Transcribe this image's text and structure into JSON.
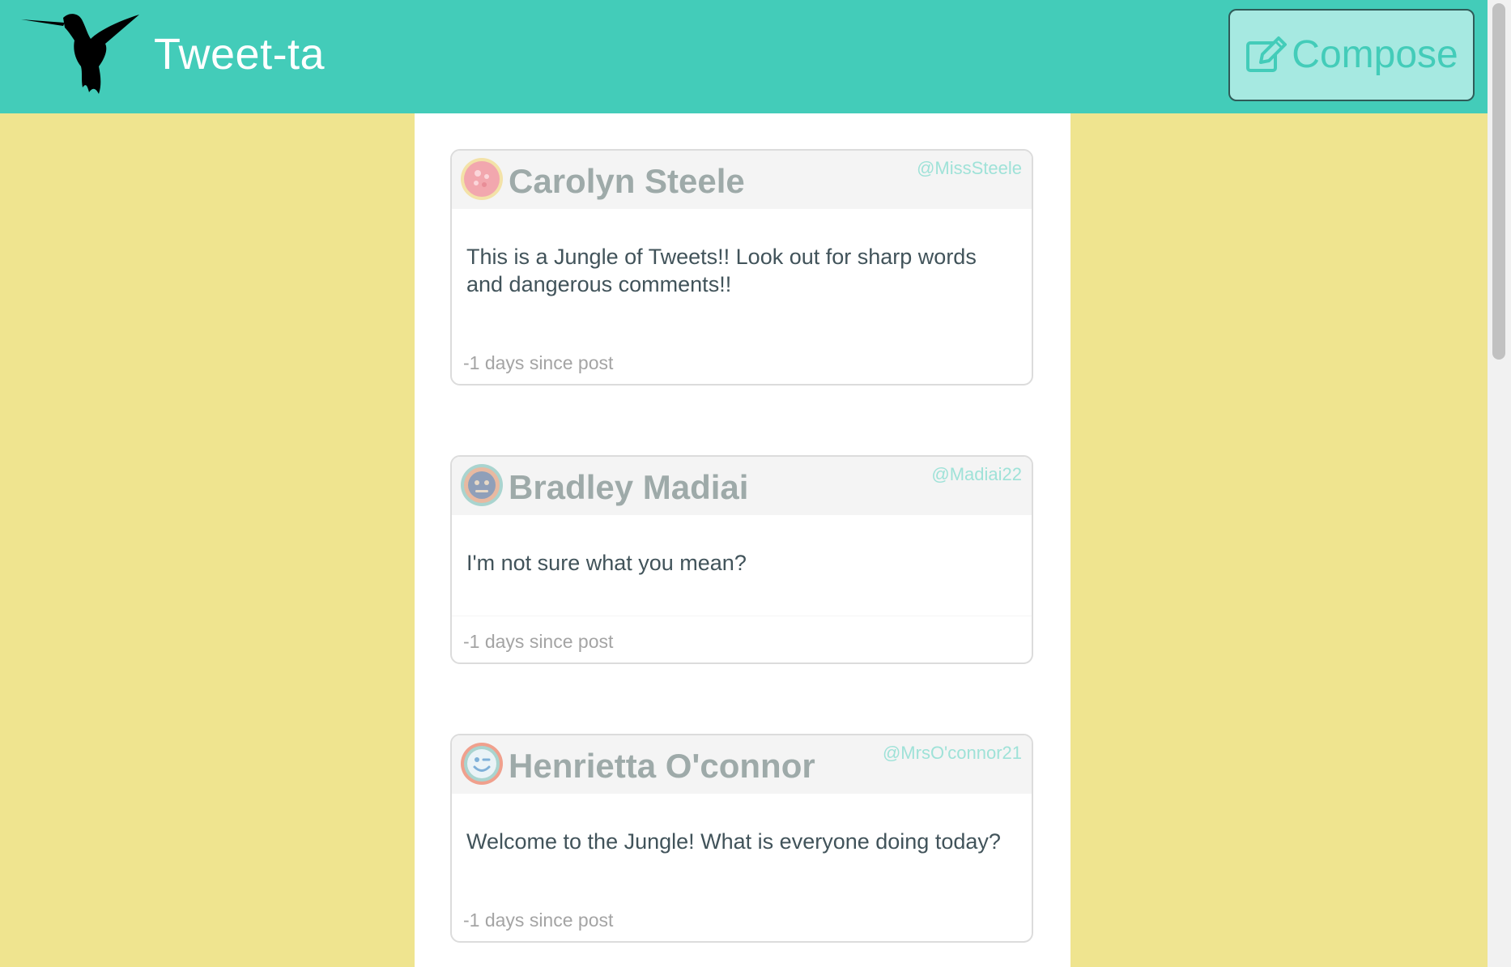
{
  "app": {
    "brand_name": "Tweet-ta",
    "compose_label": "Compose",
    "logo_icon": "hummingbird-icon",
    "compose_icon": "edit-pencil-icon"
  },
  "colors": {
    "header_bg": "#43ccb9",
    "page_bg": "#efe48f",
    "compose_bg": "#a6e9e1",
    "handle_color": "#9fe2d8",
    "name_color": "#9eaaa9"
  },
  "tweets": [
    {
      "name": "Carolyn Steele",
      "handle": "@MissSteele",
      "text": "This is a Jungle of Tweets!! Look out for sharp words and dangerous comments!!",
      "age": "-1 days since post",
      "avatar_icon": "avatar-pink-icon"
    },
    {
      "name": "Bradley Madiai",
      "handle": "@Madiai22",
      "text": "I'm not sure what you mean?",
      "age": "-1 days since post",
      "avatar_icon": "avatar-neutral-face-icon"
    },
    {
      "name": "Henrietta O'connor",
      "handle": "@MrsO'connor21",
      "text": "Welcome to the Jungle! What is everyone doing today?",
      "age": "-1 days since post",
      "avatar_icon": "avatar-wink-face-icon"
    }
  ]
}
